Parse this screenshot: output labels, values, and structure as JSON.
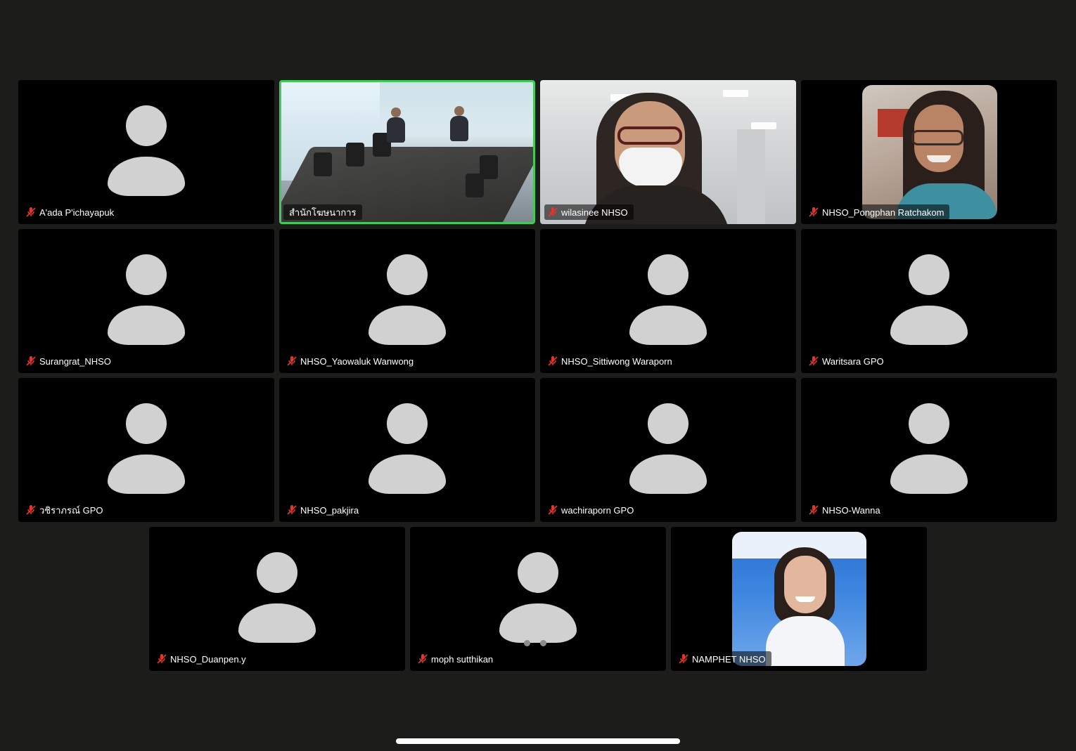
{
  "participants": [
    {
      "name": "A'ada P'ichayapuk",
      "mic": "muted"
    },
    {
      "name": "สำนักโฆษนาการ",
      "mic": "on",
      "active_speaker": true
    },
    {
      "name": "wilasinee NHSO",
      "mic": "muted"
    },
    {
      "name": "NHSO_Pongphan Ratchakom",
      "mic": "muted"
    },
    {
      "name": "Surangrat_NHSO",
      "mic": "muted"
    },
    {
      "name": "NHSO_Yaowaluk Wanwong",
      "mic": "muted"
    },
    {
      "name": "NHSO_Sittiwong Waraporn",
      "mic": "muted"
    },
    {
      "name": "Waritsara GPO",
      "mic": "muted"
    },
    {
      "name": "วชิราภรณ์ GPO",
      "mic": "muted"
    },
    {
      "name": "NHSO_pakjira",
      "mic": "muted"
    },
    {
      "name": "wachiraporn GPO",
      "mic": "muted"
    },
    {
      "name": "NHSO-Wanna",
      "mic": "muted"
    },
    {
      "name": "NHSO_Duanpen.y",
      "mic": "muted"
    },
    {
      "name": "moph sutthikan",
      "mic": "muted"
    },
    {
      "name": "NAMPHET NHSO",
      "mic": "muted"
    }
  ],
  "colors": {
    "background": "#1c1c1a",
    "tile": "#000000",
    "active_border": "#41c95a",
    "avatar": "#d1d1d1",
    "muted_icon": "#e5352b"
  },
  "icons": {
    "muted": "mic-muted-icon",
    "placeholder": "user-avatar-icon"
  },
  "pager": {
    "pages": 2,
    "current": 1
  }
}
